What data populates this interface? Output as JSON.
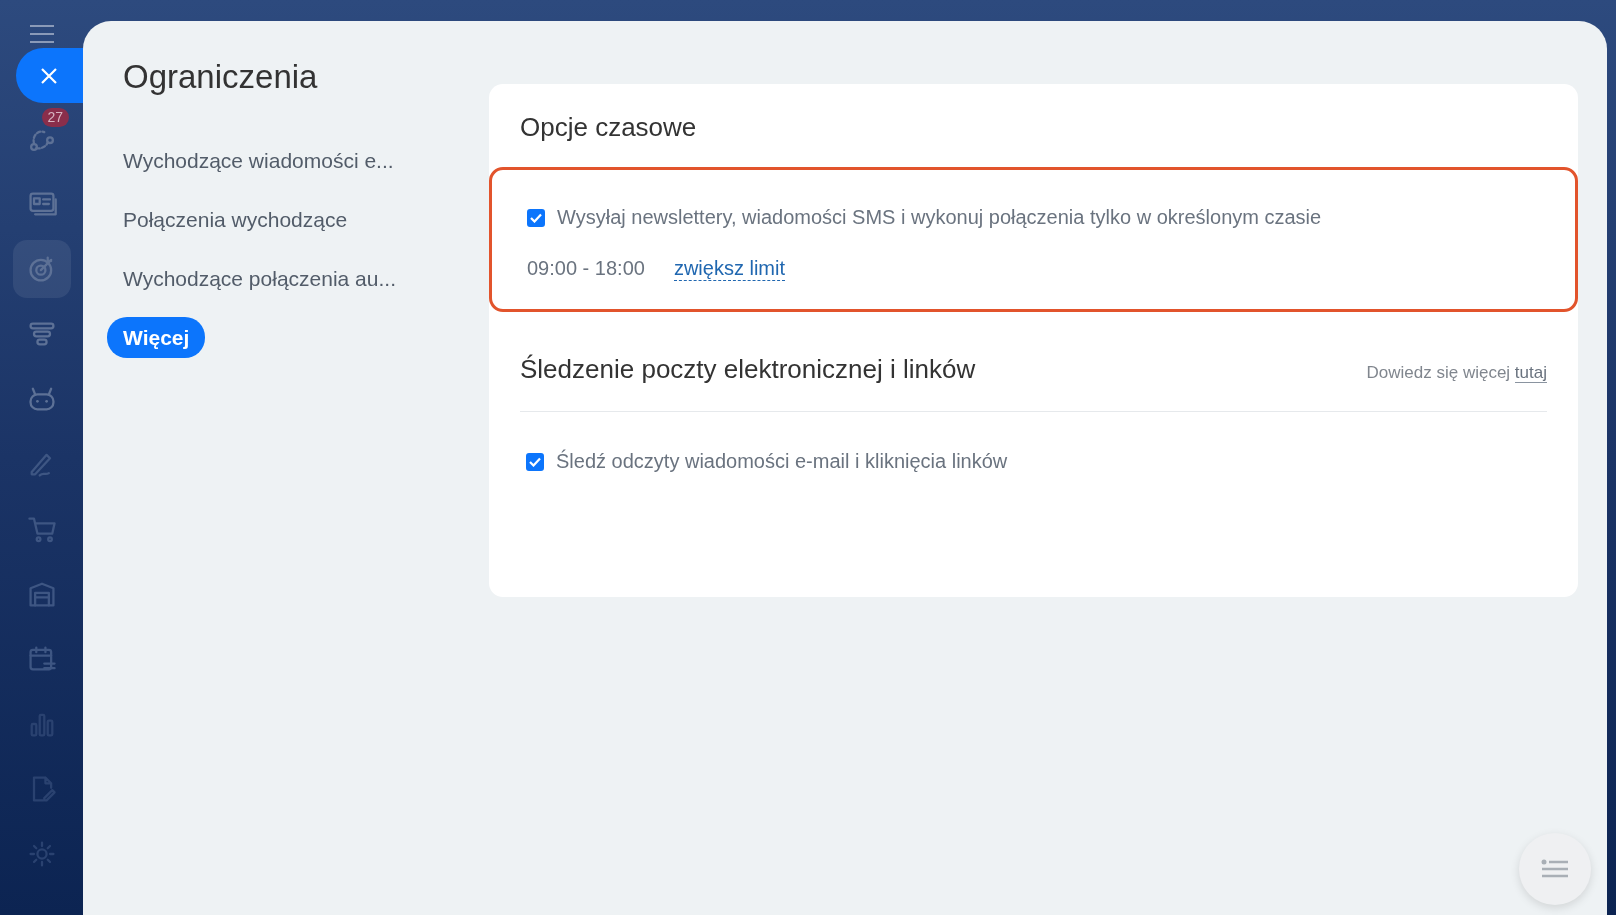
{
  "rail": {
    "items": [
      {
        "kind": "flow",
        "selected": false,
        "badge": "27"
      },
      {
        "kind": "card",
        "selected": false
      },
      {
        "kind": "target",
        "selected": true
      },
      {
        "kind": "funnel",
        "selected": false
      },
      {
        "kind": "robot",
        "selected": false
      },
      {
        "kind": "pen",
        "selected": false
      },
      {
        "kind": "cart",
        "selected": false
      },
      {
        "kind": "warehouse",
        "selected": false
      },
      {
        "kind": "calendar",
        "selected": false
      },
      {
        "kind": "chart",
        "selected": false
      },
      {
        "kind": "document",
        "selected": false
      },
      {
        "kind": "gear",
        "selected": false
      }
    ]
  },
  "panel": {
    "title": "Ograniczenia",
    "menu": [
      {
        "label": "Wychodzące wiadomości e...",
        "selected": false
      },
      {
        "label": "Połączenia wychodzące",
        "selected": false
      },
      {
        "label": "Wychodzące połączenia au...",
        "selected": false
      },
      {
        "label": "Więcej",
        "selected": true
      }
    ],
    "sections": [
      {
        "title": "Opcje czasowe",
        "highlighted": true,
        "options": [
          {
            "label": "Wysyłaj newslettery, wiadomości SMS i wykonuj połączenia tylko w określonym czasie",
            "checked": true
          }
        ],
        "time_range": "09:00 - 18:00",
        "link": "zwiększ limit"
      },
      {
        "title": "Śledzenie poczty elektronicznej i linków",
        "highlighted": false,
        "help_text": "Dowiedz się więcej",
        "help_link": "tutaj",
        "options": [
          {
            "label": "Śledź odczyty wiadomości e-mail i kliknięcia linków",
            "checked": true
          }
        ]
      }
    ]
  }
}
